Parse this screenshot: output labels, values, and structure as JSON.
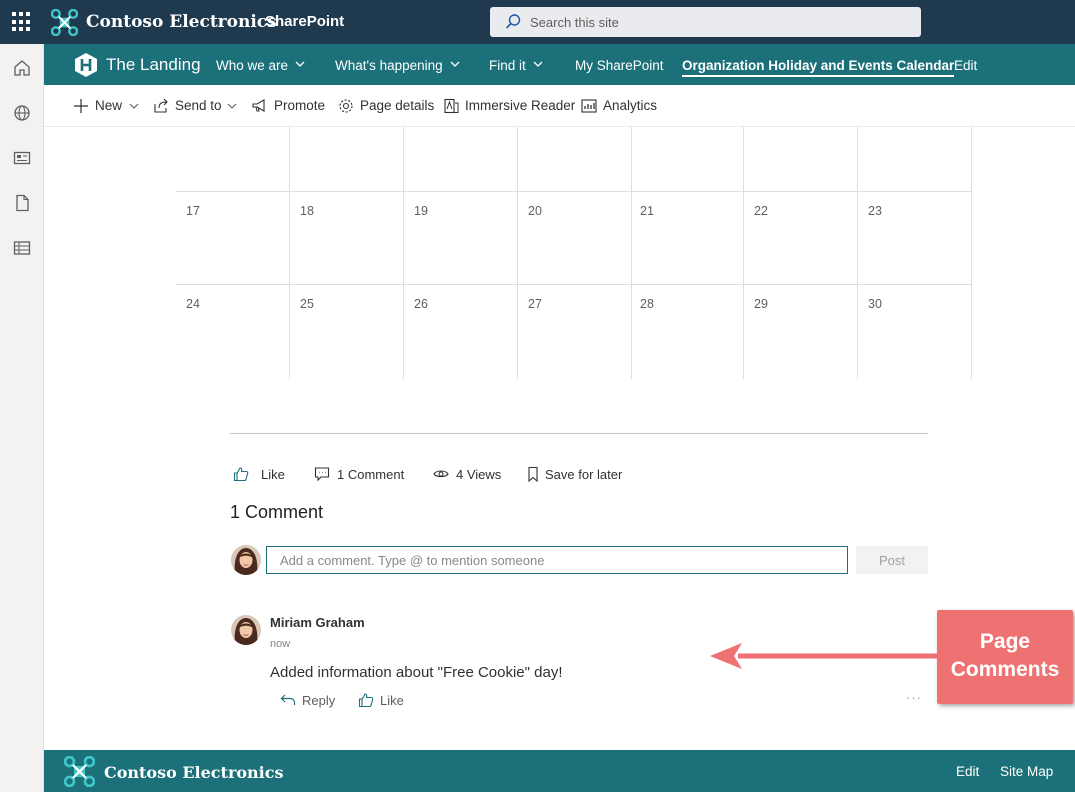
{
  "suite": {
    "brand": "Contoso Electronics",
    "app": "SharePoint",
    "search_placeholder": "Search this site"
  },
  "site": {
    "title": "The Landing",
    "nav": [
      {
        "label": "Who we are",
        "has_dropdown": true
      },
      {
        "label": "What's happening",
        "has_dropdown": true
      },
      {
        "label": "Find it",
        "has_dropdown": true
      },
      {
        "label": "My SharePoint",
        "has_dropdown": false
      },
      {
        "label": "Organization Holiday and Events Calendar",
        "active": true
      },
      {
        "label": "Edit",
        "has_dropdown": false
      }
    ]
  },
  "commands": {
    "new": "New",
    "send_to": "Send to",
    "promote": "Promote",
    "page_details": "Page details",
    "immersive_reader": "Immersive Reader",
    "analytics": "Analytics"
  },
  "calendar": {
    "weeks": [
      [
        "",
        "",
        "",
        "",
        "",
        "",
        ""
      ],
      [
        "17",
        "18",
        "19",
        "20",
        "21",
        "22",
        "23"
      ],
      [
        "24",
        "25",
        "26",
        "27",
        "28",
        "29",
        "30"
      ]
    ]
  },
  "social": {
    "like": "Like",
    "comments": "1 Comment",
    "views": "4 Views",
    "save": "Save for later"
  },
  "comments": {
    "heading": "1 Comment",
    "input_placeholder": "Add a comment. Type @ to mention someone",
    "post_label": "Post",
    "items": [
      {
        "author": "Miriam Graham",
        "time": "now",
        "text": "Added information about \"Free Cookie\" day!",
        "reply_label": "Reply",
        "like_label": "Like",
        "more": "···"
      }
    ]
  },
  "callout": {
    "line1": "Page",
    "line2": "Comments"
  },
  "footer": {
    "brand": "Contoso Electronics",
    "edit": "Edit",
    "site_map": "Site Map"
  },
  "colors": {
    "suite_bar": "#1f3a4f",
    "site_bar": "#1b7079",
    "callout": "#ef7272",
    "logo_accent": "#3ec6c9"
  }
}
